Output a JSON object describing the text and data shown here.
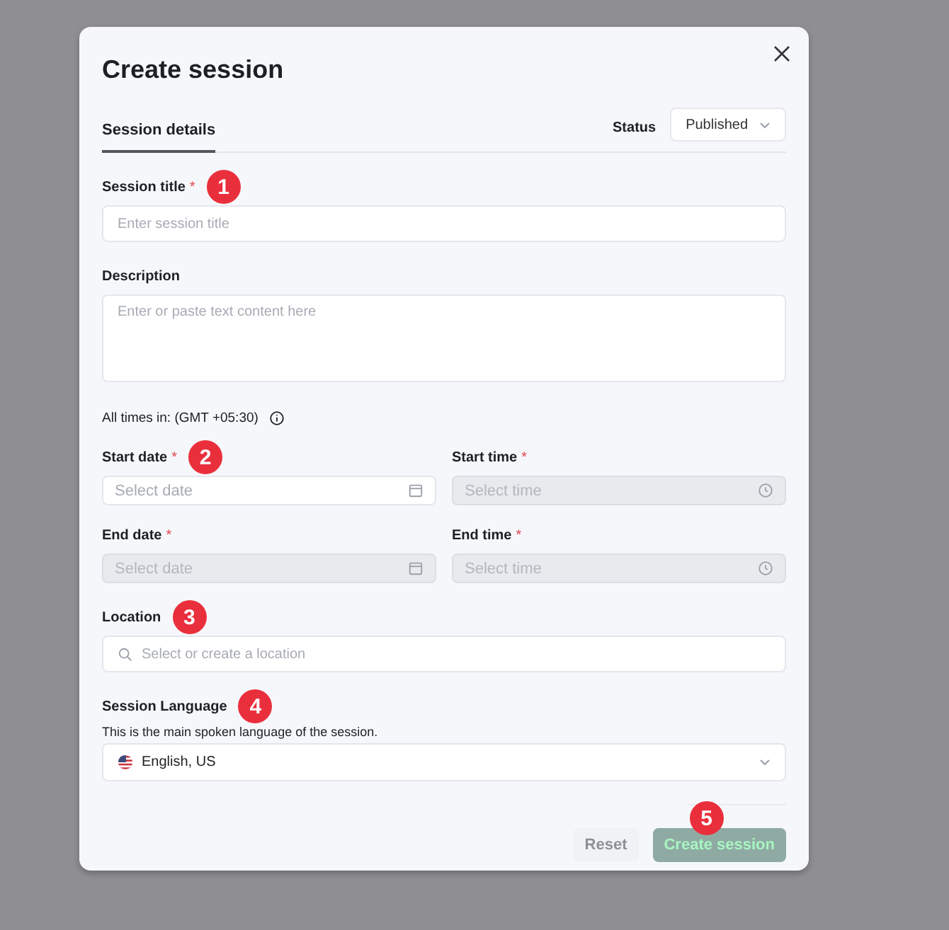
{
  "dialog": {
    "title": "Create session"
  },
  "tabs": [
    {
      "label": "Session details",
      "selected": true
    }
  ],
  "status": {
    "label": "Status",
    "value": "Published"
  },
  "fields": [
    {
      "kind": "text",
      "label": "Session title",
      "required_mark": "*",
      "placeholder": "Enter session title",
      "badge": "1"
    },
    {
      "kind": "textarea",
      "label": "Description",
      "placeholder": "Enter or paste text content here"
    }
  ],
  "timezone": {
    "text": "All times in: (GMT +05:30)"
  },
  "schedule": [
    {
      "kind": "date",
      "label": "Start date",
      "required_mark": "*",
      "placeholder": "Select date",
      "disabled": false,
      "badge": "2"
    },
    {
      "kind": "time",
      "label": "Start time",
      "required_mark": "*",
      "placeholder": "Select time",
      "disabled": true
    },
    {
      "kind": "date",
      "label": "End date",
      "required_mark": "*",
      "placeholder": "Select date",
      "disabled": true
    },
    {
      "kind": "time",
      "label": "End time",
      "required_mark": "*",
      "placeholder": "Select time",
      "disabled": true
    }
  ],
  "location": {
    "label": "Location",
    "placeholder": "Select or create a location",
    "badge": "3"
  },
  "language": {
    "label": "Session Language",
    "badge": "4",
    "help": "This is the main spoken language of the session.",
    "value": "English, US"
  },
  "buttons": [
    {
      "kind": "secondary",
      "label": "Reset",
      "disabled": true
    },
    {
      "kind": "primary",
      "label": "Create session",
      "disabled": true,
      "badge": "5"
    }
  ]
}
